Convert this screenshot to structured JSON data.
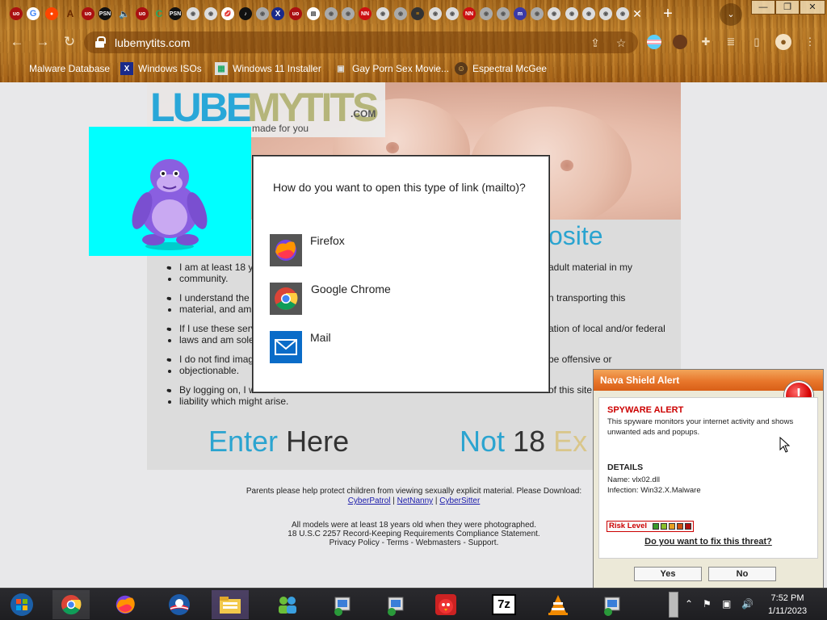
{
  "browser": {
    "url": "lubemytits.com",
    "window_controls": {
      "minimize": "—",
      "restore": "❐",
      "close": "✕"
    },
    "new_tab": "+",
    "tab_close": "✕",
    "bookmarks": [
      {
        "label": "Malware Database",
        "icon": "red-folder-icon"
      },
      {
        "label": "Windows ISOs",
        "icon": "windows-x-icon"
      },
      {
        "label": "Windows 11 Installer",
        "icon": "installer-icon"
      },
      {
        "label": "Gay Porn Sex Movie...",
        "icon": "package-icon"
      },
      {
        "label": "Espectral McGee",
        "icon": "avatar-icon"
      }
    ]
  },
  "site": {
    "logo": {
      "part1": "LUBE",
      "part2": "MY",
      "part3": "TITS",
      "tld": ".COM",
      "tagline": "made for you"
    },
    "heading_fragment": "osite",
    "rules": [
      {
        "left": "I am at least 18 y",
        "right": "adult material in my",
        "cont": "community."
      },
      {
        "left": "I understand the",
        "right": "n transporting this",
        "cont": "material, and am"
      },
      {
        "left": "If I use these serv",
        "right": "ation of local and/or federal",
        "cont": "laws and am sole"
      },
      {
        "left": "I do not find imag",
        "right": "be offensive or",
        "cont": "objectionable."
      },
      {
        "left": "By logging on, I w",
        "right": "of this site",
        "cont": "liability which might arise."
      }
    ],
    "enter_light": "Enter",
    "enter_dark": "Here",
    "not_light": "Not",
    "not_dark": "18",
    "not_faded": "Ex",
    "footer": {
      "protect_text": "Parents please help protect children from viewing sexually explicit material. Please Download:",
      "links1": [
        "CyberPatrol",
        "NetNanny",
        "CyberSitter"
      ],
      "models_text": "All models were at least 18 years old when they were photographed.",
      "usc_link": "18 U.S.C 2257 Record-Keeping Requirements Compliance Statement",
      "links2": [
        "Privacy Policy",
        "Terms",
        "Webmasters",
        "Support"
      ]
    }
  },
  "open_with_dialog": {
    "title": "How do you want to open this type of link (mailto)?",
    "apps": [
      {
        "label": "Firefox",
        "icon": "firefox-icon"
      },
      {
        "label": "Google Chrome",
        "icon": "chrome-icon"
      },
      {
        "label": "Mail",
        "icon": "mail-icon"
      }
    ]
  },
  "nava_alert": {
    "title": "Nava Shield Alert",
    "alert_heading": "SPYWARE ALERT",
    "description": "This spyware monitors your internet activity and shows unwanted ads and popups.",
    "details_heading": "DETAILS",
    "name_line": "Name: vlx02.dll",
    "infection_line": "Infection: Win32.X.Malware",
    "risk_label": "Risk Level",
    "risk_colors": [
      "#3a9a2a",
      "#8bbf2a",
      "#e8a020",
      "#d05010",
      "#b01010"
    ],
    "question": "Do you want to fix this threat?",
    "yes_label": "Yes",
    "no_label": "No"
  },
  "taskbar": {
    "apps": [
      "start-orb-icon",
      "chrome-icon",
      "firefox-icon",
      "obama-icon",
      "file-explorer-icon",
      "network-people-icon",
      "installer-icon",
      "installer-icon",
      "angry-birds-icon",
      "7zip-icon",
      "vlc-icon",
      "installer-icon"
    ],
    "sevenzip_label": "7z",
    "time": "7:52 PM",
    "date": "1/11/2023"
  }
}
